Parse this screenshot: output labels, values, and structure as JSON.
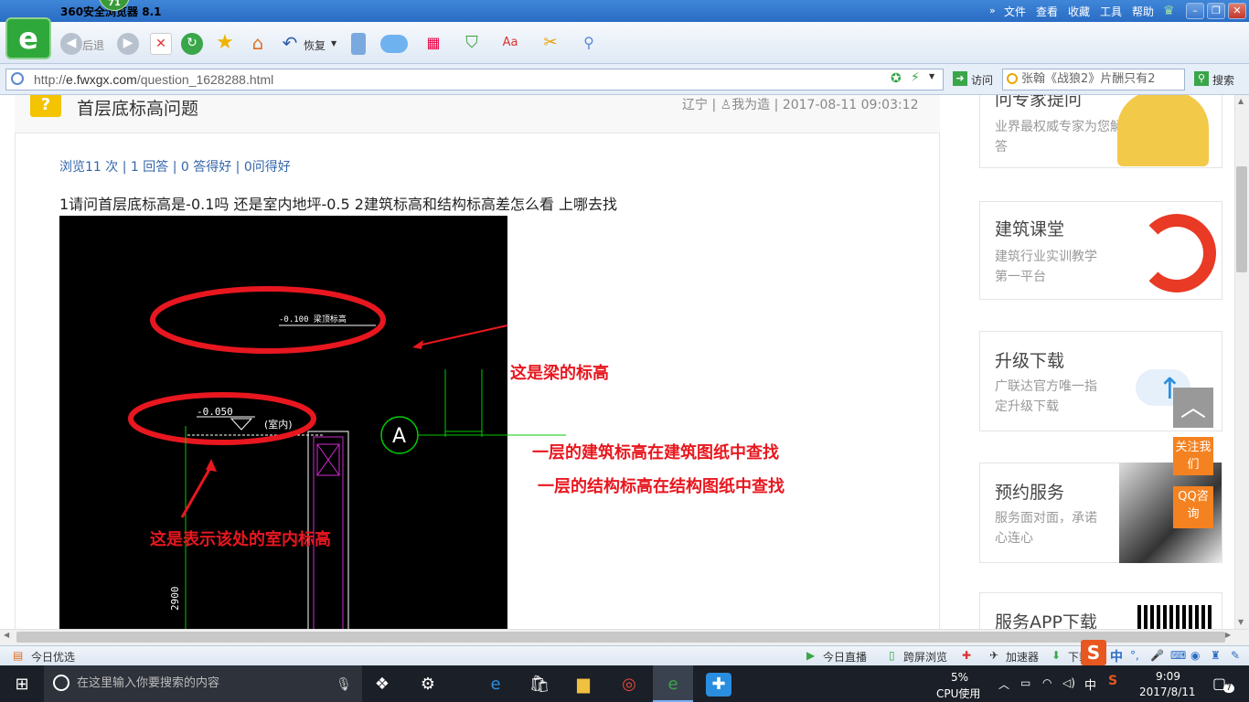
{
  "browser": {
    "title": "360安全浏览器 8.1",
    "badge": "71",
    "menu": [
      "文件",
      "查看",
      "收藏",
      "工具",
      "帮助"
    ],
    "toolbar": {
      "back_label": "后退",
      "restore_label": "恢复"
    },
    "url_domain": "e.fwxgx.com",
    "url_prefix": "http://",
    "url_path": "/question_1628288.html",
    "visit_label": "访问",
    "search_placeholder": "张翰《战狼2》片酬只有2",
    "search_button": "搜索"
  },
  "question": {
    "title": "首层底标高问题",
    "meta_region": "辽宁",
    "meta_user": "我为造",
    "meta_time": "2017-08-11 09:03:12",
    "stats": "浏览11 次 | 1 回答 | 0 答得好 | 0问得好",
    "text": "1请问首层底标高是-0.1吗 还是室内地坪-0.5 2建筑标高和结构标高差怎么看 上哪去找"
  },
  "cad": {
    "beam_label": "-0.100 梁顶标高",
    "floor_label": "-0.050",
    "room_label": "(室内)",
    "axis_label": "A",
    "dimension_label": "2900",
    "ann_beam": "这是梁的标高",
    "ann_floor": "这是表示该处的室内标高",
    "ann_arch": "一层的建筑标高在建筑图纸中查找",
    "ann_struct": "一层的结构标高在结构图纸中查找"
  },
  "sidebar": [
    {
      "title": "问专家提问",
      "desc": "业界最权威专家为您解答"
    },
    {
      "title": "建筑课堂",
      "desc": "建筑行业实训教学第一平台"
    },
    {
      "title": "升级下载",
      "desc": "广联达官方唯一指定升级下载"
    },
    {
      "title": "预约服务",
      "desc": "服务面对面，承诺心连心"
    },
    {
      "title": "服务APP下载",
      "desc": ""
    }
  ],
  "float": {
    "follow": "关注我们",
    "qq": "QQ咨询"
  },
  "statusbar": {
    "left": "今日优选",
    "live": "今日直播",
    "screen": "跨屏浏览",
    "accel": "加速器",
    "download": "下载",
    "ime": "中"
  },
  "taskbar": {
    "search_placeholder": "在这里输入你要搜索的内容",
    "cpu_percent": "5%",
    "cpu_label": "CPU使用",
    "ime": "中",
    "time": "9:09",
    "date": "2017/8/11",
    "notification_count": "7"
  },
  "colors": {
    "accent": "#2a6cc4",
    "annotation_red": "#e8171f",
    "cad_green": "#00cc00",
    "cad_magenta": "#d12bd1",
    "orange": "#f58220"
  }
}
